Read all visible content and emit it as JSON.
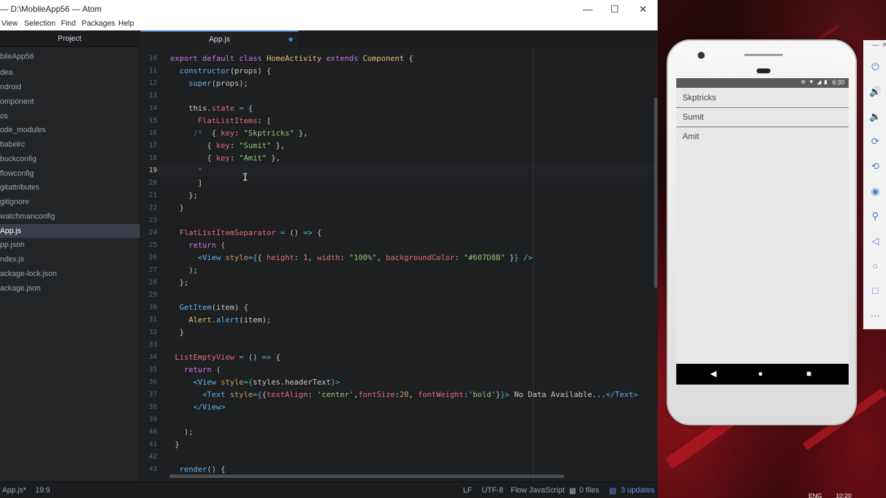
{
  "window": {
    "title": "— D:\\MobileApp56 — Atom",
    "minimize": "—",
    "maximize": "☐",
    "close": "✕"
  },
  "menu": [
    "View",
    "Selection",
    "Find",
    "Packages",
    "Help"
  ],
  "sidebar": {
    "header": "Project",
    "items": [
      {
        "label": "bileApp56",
        "selected": false
      },
      {
        "label": "dea",
        "selected": false
      },
      {
        "label": "ndroid",
        "selected": false
      },
      {
        "label": "omponent",
        "selected": false
      },
      {
        "label": "os",
        "selected": false
      },
      {
        "label": "ode_modules",
        "selected": false
      },
      {
        "label": "babelrc",
        "selected": false
      },
      {
        "label": "buckconfig",
        "selected": false
      },
      {
        "label": "flowconfig",
        "selected": false
      },
      {
        "label": "gitattributes",
        "selected": false
      },
      {
        "label": "gitignore",
        "selected": false
      },
      {
        "label": "watchmanconfig",
        "selected": false
      },
      {
        "label": "App.js",
        "selected": true
      },
      {
        "label": "pp.json",
        "selected": false
      },
      {
        "label": "ndex.js",
        "selected": false
      },
      {
        "label": "ackage-lock.json",
        "selected": false
      },
      {
        "label": "ackage.json",
        "selected": false
      }
    ]
  },
  "tab": {
    "label": "App.js"
  },
  "editor": {
    "line_numbers": [
      "10",
      "11",
      "12",
      "13",
      "14",
      "15",
      "16",
      "17",
      "18",
      "19",
      "20",
      "21",
      "22",
      "23",
      "24",
      "25",
      "26",
      "27",
      "28",
      "29",
      "30",
      "31",
      "32",
      "33",
      "34",
      "35",
      "36",
      "37",
      "38",
      "39",
      "40",
      "41",
      "42",
      "43"
    ],
    "cursor_line": "19"
  },
  "status": {
    "file": "App.js*",
    "position": "19:9",
    "line_ending": "LF",
    "encoding": "UTF-8",
    "grammar": "Flow JavaScript",
    "files": "0 files",
    "updates": "3 updates"
  },
  "emulator": {
    "clock": "6:30",
    "list_items": [
      "Skptricks",
      "Sumit",
      "Amit"
    ],
    "separator_color": "#607D8B",
    "nav": {
      "back": "◀",
      "home": "●",
      "recents": "■"
    },
    "toolbar": [
      "power-icon",
      "volume-up-icon",
      "volume-down-icon",
      "rotate-left-icon",
      "rotate-right-icon",
      "camera-icon",
      "zoom-icon",
      "back-icon",
      "home-icon",
      "overview-icon",
      "more-icon"
    ]
  },
  "taskbar": {
    "lang": "ENG",
    "time": "10:20"
  }
}
